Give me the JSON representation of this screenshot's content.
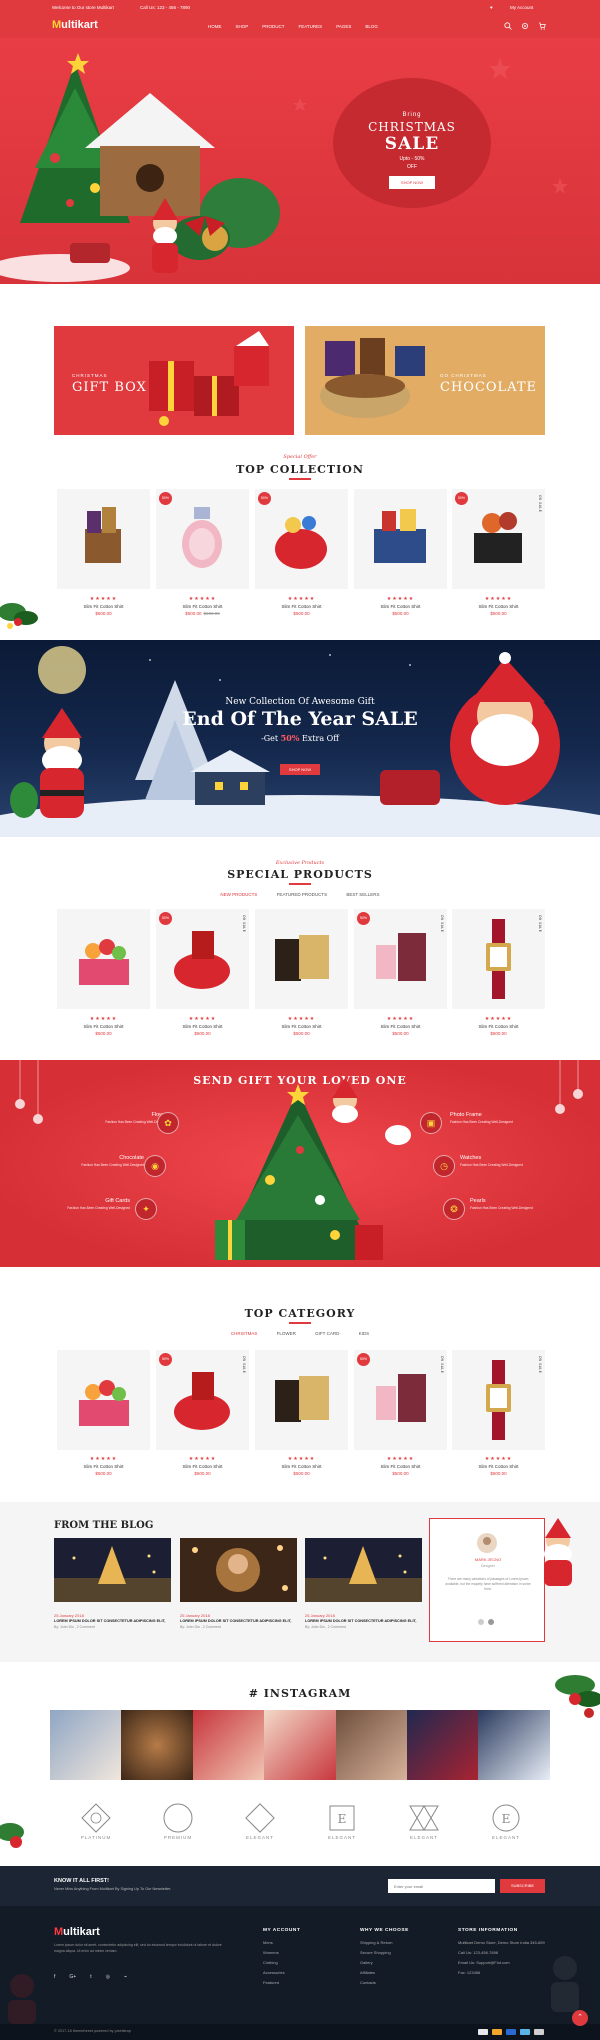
{
  "topbar": {
    "welcome": "Welcome to Our store Multikart",
    "phone": "Call Us: 123 - 456 - 7890",
    "wishlist": "♥",
    "account": "My Account"
  },
  "header": {
    "logo_m": "M",
    "logo_rest": "ultikart",
    "nav": [
      "HOME",
      "SHOP",
      "PRODUCT",
      "FEATURES",
      "PAGES",
      "BLOG"
    ],
    "icons": [
      "search-icon",
      "gear-icon",
      "cart-icon"
    ]
  },
  "hero": {
    "line1": "Bring",
    "line2": "CHRISTMAS",
    "line3": "SALE",
    "line4": "Upto - 50%",
    "line5": "OFF",
    "button": "SHOP NOW"
  },
  "banners": [
    {
      "small": "CHRISTMAS",
      "large": "GIFT BOX"
    },
    {
      "small": "GO CHRISTMAS",
      "large": "CHOCOLATE"
    }
  ],
  "top_collection": {
    "subtitle": "Special Offer",
    "title": "TOP COLLECTION",
    "products": [
      {
        "badge": "",
        "onsale": "",
        "stars": "★★★★★",
        "name": "Slim Fit Cotton Shirt",
        "price": "$500.00",
        "old": ""
      },
      {
        "badge": "50%",
        "onsale": "",
        "stars": "★★★★★",
        "name": "Slim Fit Cotton Shirt",
        "price": "$500.00",
        "old": "$600.00"
      },
      {
        "badge": "50%",
        "onsale": "",
        "stars": "★★★★★",
        "name": "Slim Fit Cotton Shirt",
        "price": "$500.00",
        "old": ""
      },
      {
        "badge": "",
        "onsale": "",
        "stars": "★★★★★",
        "name": "Slim Fit Cotton Shirt",
        "price": "$500.00",
        "old": ""
      },
      {
        "badge": "50%",
        "onsale": "ON SALE",
        "stars": "★★★★★",
        "name": "Slim Fit Cotton Shirt",
        "price": "$500.00",
        "old": ""
      }
    ]
  },
  "parallax": {
    "line1": "New Collection Of Awesome Gift",
    "line2": "End Of The Year SALE",
    "line3_pre": "-Get ",
    "line3_pct": "50%",
    "line3_post": " Extra Off",
    "button": "SHOP NOW"
  },
  "special_products": {
    "subtitle": "Exclusive Products",
    "title": "SPECIAL PRODUCTS",
    "tabs": [
      "NEW PRODUCTS",
      "FEATURED PRODUCTS",
      "BEST SELLERS"
    ],
    "products": [
      {
        "badge": "",
        "onsale": "",
        "stars": "★★★★★",
        "name": "Slim Fit Cotton Shirt",
        "price": "$500.00"
      },
      {
        "badge": "50%",
        "onsale": "ON SALE",
        "stars": "★★★★★",
        "name": "Slim Fit Cotton Shirt",
        "price": "$500.00"
      },
      {
        "badge": "",
        "onsale": "",
        "stars": "★★★★★",
        "name": "Slim Fit Cotton Shirt",
        "price": "$500.00"
      },
      {
        "badge": "50%",
        "onsale": "ON SALE",
        "stars": "★★★★★",
        "name": "Slim Fit Cotton Shirt",
        "price": "$500.00"
      },
      {
        "badge": "",
        "onsale": "ON SALE",
        "stars": "★★★★★",
        "name": "Slim Fit Cotton Shirt",
        "price": "$500.00"
      }
    ]
  },
  "gift_section": {
    "title": "SEND GIFT YOUR LOVED ONE",
    "left": [
      {
        "label": "Flower",
        "desc": "Fashion Has Been Creating Well-Designed"
      },
      {
        "label": "Chocolate",
        "desc": "Fashion Has Been Creating Well-Designed"
      },
      {
        "label": "Gift Cards",
        "desc": "Fashion Has Been Creating Well-Designed"
      }
    ],
    "right": [
      {
        "label": "Photo Frame",
        "desc": "Fashion Has Been Creating Well-Designed"
      },
      {
        "label": "Watches",
        "desc": "Fashion Has Been Creating Well-Designed"
      },
      {
        "label": "Pearls",
        "desc": "Fashion Has Been Creating Well-Designed"
      }
    ]
  },
  "top_category": {
    "title": "TOP CATEGORY",
    "tabs": [
      "CHRISTMAS",
      "FLOWER",
      "GIFT CARD",
      "KIDS"
    ],
    "products": [
      {
        "badge": "",
        "onsale": "",
        "stars": "★★★★★",
        "name": "Slim Fit Cotton Shirt",
        "price": "$500.00"
      },
      {
        "badge": "50%",
        "onsale": "ON SALE",
        "stars": "★★★★★",
        "name": "Slim Fit Cotton Shirt",
        "price": "$500.00"
      },
      {
        "badge": "",
        "onsale": "",
        "stars": "★★★★★",
        "name": "Slim Fit Cotton Shirt",
        "price": "$500.00"
      },
      {
        "badge": "50%",
        "onsale": "ON SALE",
        "stars": "★★★★★",
        "name": "Slim Fit Cotton Shirt",
        "price": "$500.00"
      },
      {
        "badge": "",
        "onsale": "ON SALE",
        "stars": "★★★★★",
        "name": "Slim Fit Cotton Shirt",
        "price": "$500.00"
      }
    ]
  },
  "blog": {
    "title": "FROM THE BLOG",
    "posts": [
      {
        "date": "25 January 2018",
        "title": "LOREM IPSUM DOLOR SIT CONSECTETUR ADIPISCING ELIT,",
        "by": "By: John Dio , 2 Comment"
      },
      {
        "date": "25 January 2018",
        "title": "LOREM IPSUM DOLOR SIT CONSECTETUR ADIPISCING ELIT,",
        "by": "By: John Dio , 2 Comment"
      },
      {
        "date": "25 January 2018",
        "title": "LOREM IPSUM DOLOR SIT CONSECTETUR ADIPISCING ELIT,",
        "by": "By: John Dio , 2 Comment"
      }
    ],
    "testimonial": {
      "name": "MARK JECNO",
      "role": "Designer",
      "text": "There are many variations of passages of Lorem Ipsum available, but the majority have suffered alteration in some form."
    }
  },
  "instagram": {
    "title": "# INSTAGRAM"
  },
  "brands": [
    "PLATINUM",
    "PREMIUM",
    "ELEGANT",
    "ELEGANT",
    "ELEGANT",
    "ELEGANT"
  ],
  "newsletter": {
    "heading": "KNOW IT ALL FIRST!",
    "text": "Never Miss Anything From Multikart By Signing Up To Our Newsletter.",
    "placeholder": "Enter your email",
    "button": "SUBSCRIBE"
  },
  "footer": {
    "logo_m": "M",
    "logo_rest": "ultikart",
    "about": "Lorem ipsum dolor sit amet, consectetur adipiscing elit, sed do eiusmod tempor incididunt ut labore et dolore magna aliqua. Ut enim ad minim veniam.",
    "social": [
      "f",
      "G+",
      "t",
      "◎",
      "⌁"
    ],
    "my_account": {
      "title": "MY ACCOUNT",
      "items": [
        "Mens",
        "Womens",
        "Clothing",
        "Accessories",
        "Featured"
      ]
    },
    "why_we_choose": {
      "title": "WHY WE CHOOSE",
      "items": [
        "Shipping & Return",
        "Secure Shopping",
        "Gallery",
        "Affiliates",
        "Contacts"
      ]
    },
    "store_info": {
      "title": "STORE INFORMATION",
      "items": [
        "Multikart Demo Store, Demo Store India 345-659",
        "Call Us: 123-456-7898",
        "Email Us: Support@Fiot.com",
        "Fax: 123456"
      ]
    },
    "copyright": "© 2017-18 themeforest powered by pixelstrap"
  },
  "colors": {
    "accent": "#e03a3e",
    "dark": "#131b27",
    "gold": "#e2ac64"
  }
}
